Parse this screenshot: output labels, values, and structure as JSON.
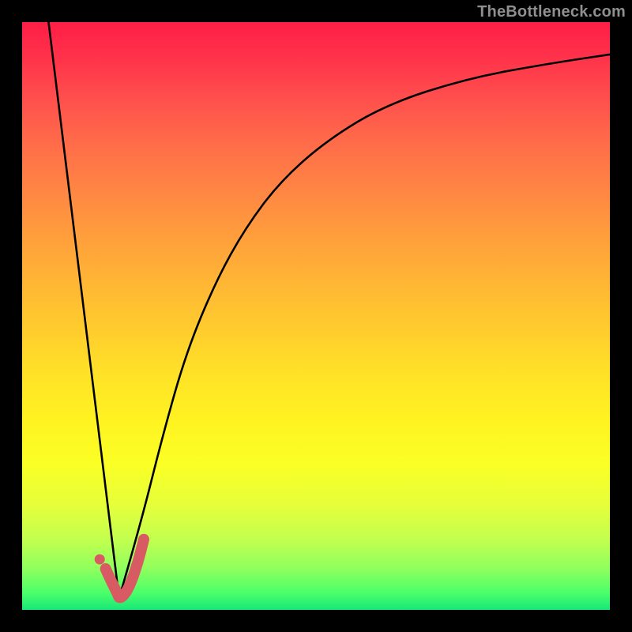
{
  "watermark": {
    "text": "TheBottleneck.com"
  },
  "chart_data": {
    "type": "line",
    "title": "",
    "xlabel": "",
    "ylabel": "",
    "xlim": [
      0,
      100
    ],
    "ylim": [
      0,
      100
    ],
    "grid": false,
    "series": [
      {
        "name": "left-branch",
        "x": [
          4.5,
          16.5
        ],
        "values": [
          100,
          2
        ],
        "color": "#000000"
      },
      {
        "name": "right-branch",
        "x": [
          16.5,
          20,
          24,
          28,
          33,
          38,
          44,
          52,
          62,
          76,
          90,
          100
        ],
        "values": [
          2,
          14,
          30,
          44,
          56,
          65,
          73,
          80,
          86,
          90.5,
          93,
          94.5
        ],
        "color": "#000000"
      },
      {
        "name": "hook-accent",
        "x": [
          14.2,
          15.0,
          15.8,
          16.3,
          16.5,
          17.2,
          18.3,
          19.7,
          20.7
        ],
        "values": [
          7.0,
          5.2,
          3.6,
          2.6,
          2.0,
          2.3,
          4.0,
          8.0,
          12.0
        ],
        "color": "#d85a62"
      },
      {
        "name": "hook-dot",
        "x": [
          13.2
        ],
        "values": [
          8.6
        ],
        "color": "#d85a62"
      }
    ]
  }
}
